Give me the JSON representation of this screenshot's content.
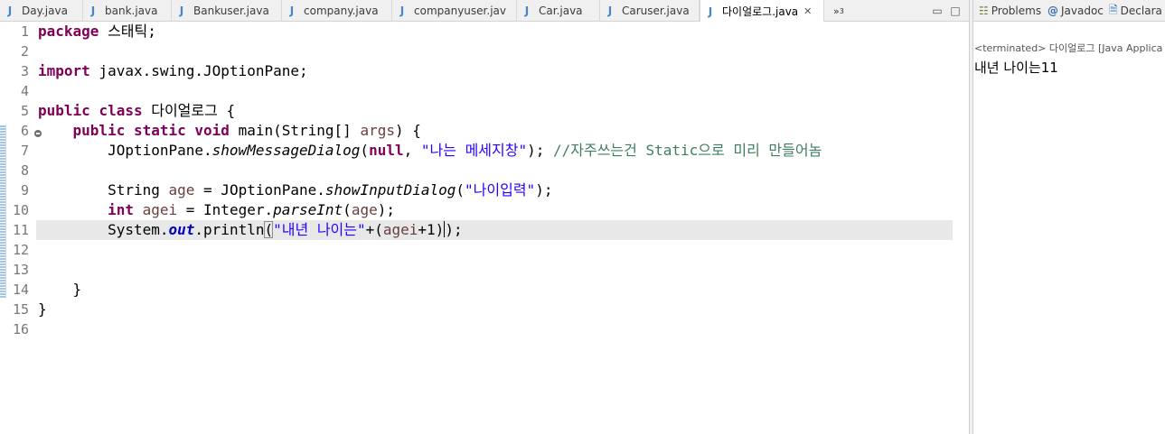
{
  "editor_tabs": [
    {
      "label": "Day.java",
      "icon": "java-file-icon",
      "active": false
    },
    {
      "label": "bank.java",
      "icon": "java-file-icon",
      "active": false
    },
    {
      "label": "Bankuser.java",
      "icon": "java-file-icon",
      "active": false
    },
    {
      "label": "company.java",
      "icon": "java-file-icon",
      "active": false
    },
    {
      "label": "companyuser.jav",
      "icon": "java-file-icon",
      "active": false
    },
    {
      "label": "Car.java",
      "icon": "java-file-icon",
      "active": false
    },
    {
      "label": "Caruser.java",
      "icon": "java-file-icon",
      "active": false
    },
    {
      "label": "다이얼로그.java",
      "icon": "java-file-icon",
      "active": true
    }
  ],
  "overflow_count": "3",
  "right_tabs": [
    {
      "label": "Problems",
      "icon": "problems-icon"
    },
    {
      "label": "Javadoc",
      "icon": "javadoc-icon"
    },
    {
      "label": "Declara",
      "icon": "declaration-icon"
    }
  ],
  "console": {
    "status": "<terminated> 다이얼로그 [Java Applica",
    "output": "내년 나이는11"
  },
  "line_numbers": [
    "1",
    "2",
    "3",
    "4",
    "5",
    "6",
    "7",
    "8",
    "9",
    "10",
    "11",
    "12",
    "13",
    "14",
    "15",
    "16"
  ],
  "code": {
    "l1": {
      "kw": "package",
      "rest": " 스태틱;"
    },
    "l3": {
      "kw": "import",
      "rest": " javax.swing.JOptionPane;"
    },
    "l5": {
      "kw1": "public",
      "kw2": "class",
      "rest": " 다이얼로그 {"
    },
    "l6": {
      "indent": "    ",
      "kw1": "public",
      "kw2": "static",
      "kw3": "void",
      "pre": " main(String[] ",
      "param": "args",
      "post": ") {"
    },
    "l7": {
      "indent": "        ",
      "pre": "JOptionPane.",
      "method": "showMessageDialog",
      "open": "(",
      "kw": "null",
      "comma": ", ",
      "str": "\"나는 메세지창\"",
      "close": "); ",
      "comment": "//자주쓰는건 Static으로 미리 만들어놈"
    },
    "l9": {
      "indent": "        ",
      "type": "String ",
      "var": "age",
      "mid": " = JOptionPane.",
      "method": "showInputDialog",
      "open": "(",
      "str": "\"나이입력\"",
      "close": ");"
    },
    "l10": {
      "indent": "        ",
      "kw": "int",
      "sp": " ",
      "var": "agei",
      "mid": " = Integer.",
      "method": "parseInt",
      "open": "(",
      "arg": "age",
      "close": ");"
    },
    "l11": {
      "indent": "        ",
      "pre": "System.",
      "field": "out",
      "mid": ".println",
      "open": "(",
      "str": "\"내년 나이는\"",
      "plus": "+(",
      "var": "agei",
      "tail": "+1)",
      "close2": ")",
      "end": ";"
    },
    "l14": {
      "text": "    }"
    },
    "l15": {
      "text": "}"
    }
  }
}
